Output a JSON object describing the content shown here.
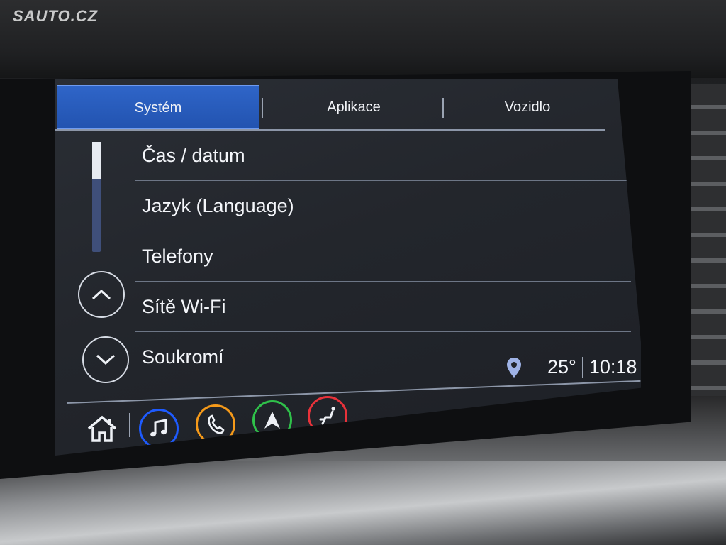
{
  "watermark": "SAUTO.CZ",
  "tabs": [
    {
      "label": "Systém",
      "active": true
    },
    {
      "label": "Aplikace",
      "active": false
    },
    {
      "label": "Vozidlo",
      "active": false
    }
  ],
  "menu_items": [
    {
      "label": "Čas / datum"
    },
    {
      "label": "Jazyk (Language)"
    },
    {
      "label": "Telefony"
    },
    {
      "label": "Sítě Wi-Fi"
    },
    {
      "label": "Soukromí"
    }
  ],
  "status": {
    "temperature": "25°",
    "time": "10:18",
    "location_icon": "location-pin-icon"
  },
  "dock": [
    {
      "icon": "home-icon"
    },
    {
      "icon": "music-note-icon",
      "color": "#1e5bff"
    },
    {
      "icon": "phone-icon",
      "color": "#f59a1a"
    },
    {
      "icon": "navigation-arrow-icon",
      "color": "#2fc14a"
    },
    {
      "icon": "seat-icon",
      "color": "#e8323a"
    }
  ],
  "colors": {
    "accent": "#2a5cc0",
    "text": "#f1f3f7",
    "background": "#23262c"
  }
}
